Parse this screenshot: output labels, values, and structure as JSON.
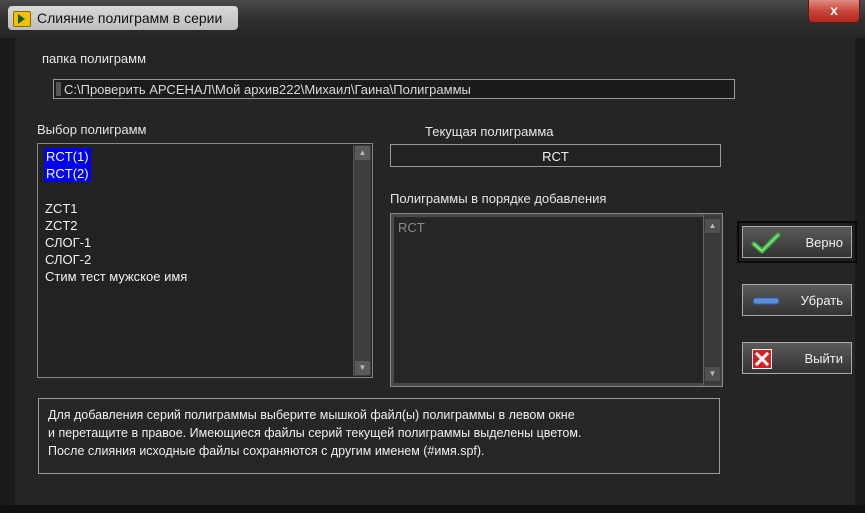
{
  "window": {
    "title": "Слияние полиграмм в серии",
    "close_label": "x"
  },
  "folder": {
    "label": "папка полиграмм",
    "path": "C:\\Проверить АРСЕНАЛ\\Мой архив222\\Михаил\\Гаина\\Полиграммы"
  },
  "left_list": {
    "label": "Выбор полиграмм",
    "items": [
      "RCT(1)",
      "RCT(2)",
      "",
      "ZCT1",
      "ZCT2",
      "СЛОГ-1",
      "СЛОГ-2",
      "Стим тест мужское имя"
    ],
    "selected": [
      "RCT(1)",
      "RCT(2)"
    ]
  },
  "current": {
    "label": "Текущая полиграмма",
    "value": "RCT"
  },
  "right_list": {
    "label": "Полиграммы в порядке добавления",
    "items": [
      "RCT"
    ]
  },
  "buttons": {
    "ok_label": "Верно",
    "remove_label": "Убрать",
    "exit_label": "Выйти"
  },
  "info": {
    "line1": "Для добавления серий полиграммы выберите мышкой файл(ы) полиграммы в левом окне",
    "line2": "и перетащите в правое. Имеющиеся файлы серий текущей полиграммы выделены цветом.",
    "line3": "После слияния исходные файлы сохраняются с другим именем (#имя.spf)."
  },
  "icons": {
    "app": "labview-vi-icon",
    "ok": "check-icon",
    "remove": "minus-icon",
    "exit": "x-icon"
  },
  "colors": {
    "selection": "#0000ee",
    "path_text": "#d9d9d9",
    "close_button": "#c9463a",
    "ok_check": "#37b03a",
    "exit_icon": "#d42020"
  }
}
